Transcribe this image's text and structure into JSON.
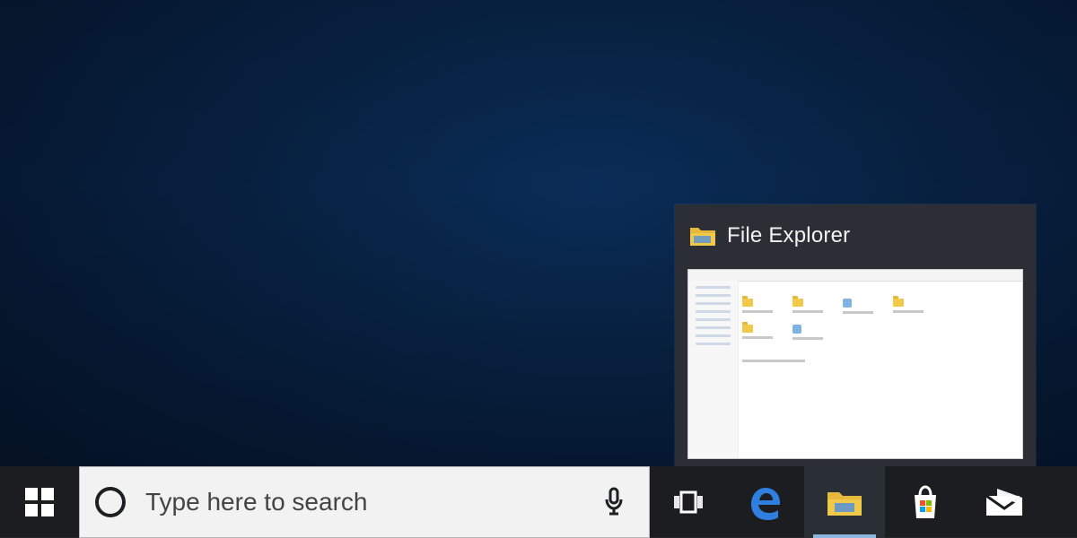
{
  "preview": {
    "title": "File Explorer",
    "app_icon": "folder-icon"
  },
  "taskbar": {
    "start_icon": "windows-start-icon",
    "search_placeholder": "Type here to search",
    "search_icons": [
      "cortana-icon",
      "microphone-icon"
    ],
    "apps": [
      {
        "name": "task-view",
        "icon": "task-view-icon"
      },
      {
        "name": "edge",
        "icon": "edge-icon"
      },
      {
        "name": "file-explorer",
        "icon": "file-explorer-icon",
        "active": true
      },
      {
        "name": "microsoft-store",
        "icon": "store-icon"
      },
      {
        "name": "mail",
        "icon": "mail-icon"
      }
    ]
  },
  "colors": {
    "desktop": "#061a35",
    "taskbar": "#1b1d20",
    "search_bg": "#f2f2f2",
    "active_indicator": "#8fb6de",
    "edge_blue": "#2f7fe0",
    "folder_yellow": "#f0c84a"
  }
}
